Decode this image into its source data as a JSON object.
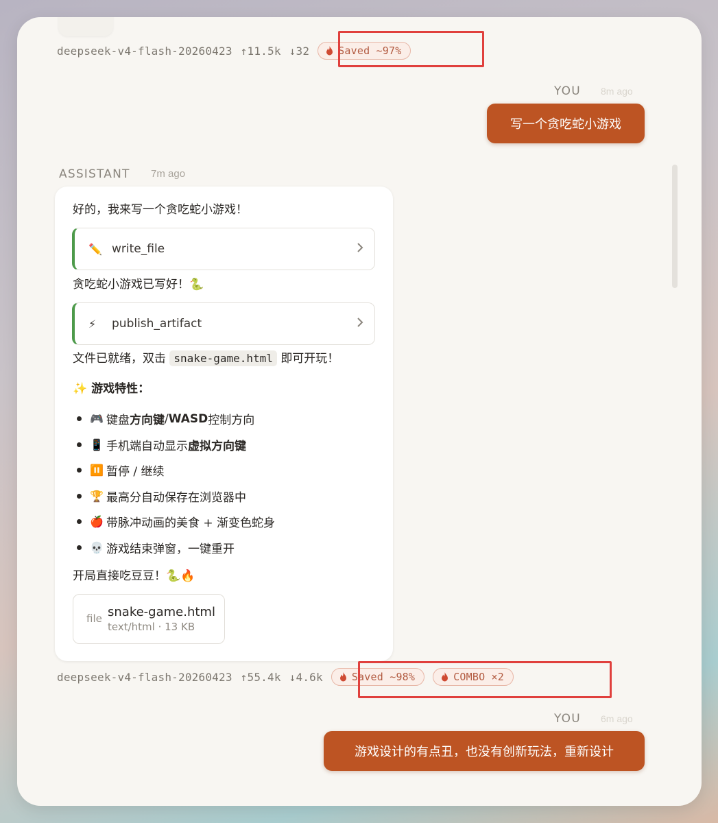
{
  "colors": {
    "user_bubble": "#bd5423",
    "pill_text": "#b25a40",
    "tool_accent": "#4d9a4a",
    "highlight_box": "#e0403d"
  },
  "first_meta": {
    "model": "deepseek-v4-flash-20260423",
    "tokens_in": "↑11.5k",
    "tokens_out": "↓32",
    "saved": "Saved ~97%"
  },
  "user_message_1": {
    "role": "YOU",
    "time": "8m ago",
    "text": "写一个贪吃蛇小游戏"
  },
  "assistant_message": {
    "role": "ASSISTANT",
    "time": "7m ago",
    "intro": "好的，我来写一个贪吃蛇小游戏！",
    "tool_1": {
      "icon": "pencil-icon",
      "name": "write_file"
    },
    "after_tool_1": "贪吃蛇小游戏已写好！🐍",
    "tool_2": {
      "icon": "lightning-icon",
      "name": "publish_artifact"
    },
    "ready_prefix": "文件已就绪，双击",
    "ready_file": "snake-game.html",
    "ready_suffix": "即可开玩！",
    "features_title": "✨ 游戏特性：",
    "features": [
      {
        "emoji": "🎮",
        "parts": [
          "键盘 ",
          "方向键",
          " / ",
          "WASD",
          " 控制方向"
        ]
      },
      {
        "emoji": "📱",
        "parts": [
          "手机端自动显示 ",
          "虚拟方向键",
          "",
          "",
          ""
        ]
      },
      {
        "emoji": "⏸️",
        "parts": [
          "暂停 / 继续",
          "",
          "",
          "",
          ""
        ]
      },
      {
        "emoji": "🏆",
        "parts": [
          "最高分自动保存在浏览器中",
          "",
          "",
          "",
          ""
        ]
      },
      {
        "emoji": "🍎",
        "parts": [
          "带脉冲动画的美食 + 渐变色蛇身",
          "",
          "",
          "",
          ""
        ]
      },
      {
        "emoji": "💀",
        "parts": [
          "游戏结束弹窗，一键重开",
          "",
          "",
          "",
          ""
        ]
      }
    ],
    "outro": "开局直接吃豆豆！🐍🔥",
    "file": {
      "type": "file",
      "name": "snake-game.html",
      "meta": "text/html · 13 KB"
    }
  },
  "second_meta": {
    "model": "deepseek-v4-flash-20260423",
    "tokens_in": "↑55.4k",
    "tokens_out": "↓4.6k",
    "saved": "Saved ~98%",
    "combo": "COMBO ×2"
  },
  "user_message_2": {
    "role": "YOU",
    "time": "6m ago",
    "text": "游戏设计的有点丑，也没有创新玩法，重新设计"
  }
}
